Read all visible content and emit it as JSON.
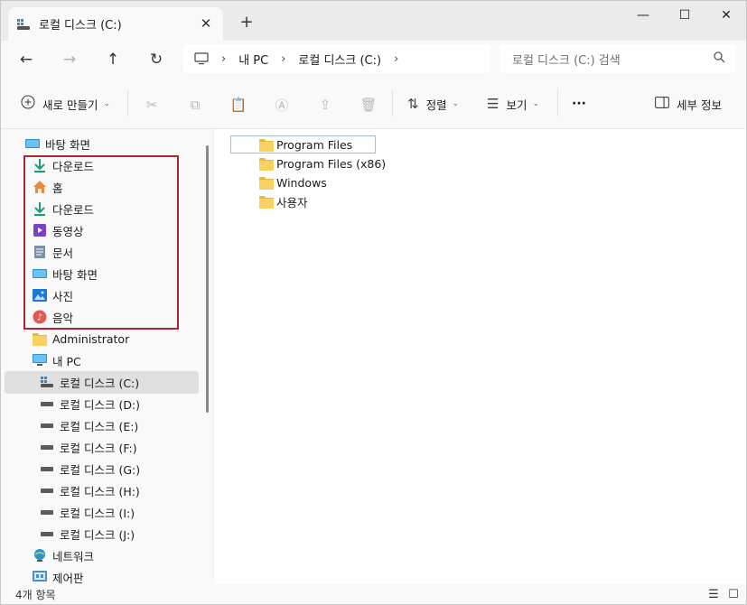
{
  "window": {
    "tab_title": "로컬 디스크 (C:)",
    "tab_close": "✕",
    "new_tab": "+",
    "minimize": "—",
    "maximize": "☐",
    "close": "✕"
  },
  "address": {
    "back": "←",
    "forward": "→",
    "up": "↑",
    "refresh": "↻",
    "breadcrumb": [
      "내 PC",
      "로컬 디스크 (C:)"
    ],
    "search_placeholder": "로컬 디스크 (C:) 검색"
  },
  "toolbar": {
    "new_label": "새로 만들기",
    "sort_label": "정렬",
    "view_label": "보기",
    "more_label": "···",
    "details_label": "세부 정보"
  },
  "sidebar": {
    "items": [
      {
        "label": "바탕 화면",
        "icon": "desktop-icon"
      },
      {
        "label": "다운로드",
        "icon": "download-icon"
      },
      {
        "label": "홈",
        "icon": "home-icon"
      },
      {
        "label": "다운로드",
        "icon": "download-icon"
      },
      {
        "label": "동영상",
        "icon": "video-icon"
      },
      {
        "label": "문서",
        "icon": "document-icon"
      },
      {
        "label": "바탕 화면",
        "icon": "desktop-icon"
      },
      {
        "label": "사진",
        "icon": "pictures-icon"
      },
      {
        "label": "음악",
        "icon": "music-icon"
      },
      {
        "label": "Administrator",
        "icon": "folder-icon"
      },
      {
        "label": "내 PC",
        "icon": "computer-icon"
      },
      {
        "label": "로컬 디스크 (C:)",
        "icon": "windows-drive-icon"
      },
      {
        "label": "로컬 디스크 (D:)",
        "icon": "drive-icon"
      },
      {
        "label": "로컬 디스크 (E:)",
        "icon": "drive-icon"
      },
      {
        "label": "로컬 디스크 (F:)",
        "icon": "drive-icon"
      },
      {
        "label": "로컬 디스크 (G:)",
        "icon": "drive-icon"
      },
      {
        "label": "로컬 디스크 (H:)",
        "icon": "drive-icon"
      },
      {
        "label": "로컬 디스크 (I:)",
        "icon": "drive-icon"
      },
      {
        "label": "로컬 디스크 (J:)",
        "icon": "drive-icon"
      },
      {
        "label": "네트워크",
        "icon": "network-icon"
      },
      {
        "label": "제어판",
        "icon": "control-panel-icon"
      }
    ]
  },
  "files": [
    {
      "name": "Program Files"
    },
    {
      "name": "Program Files (x86)"
    },
    {
      "name": "Windows"
    },
    {
      "name": "사용자"
    }
  ],
  "status": {
    "item_count": "4개 항목"
  },
  "colors": {
    "accent": "#0067c0",
    "highlight_box": "#b3232b",
    "folder": "#f7d262"
  }
}
